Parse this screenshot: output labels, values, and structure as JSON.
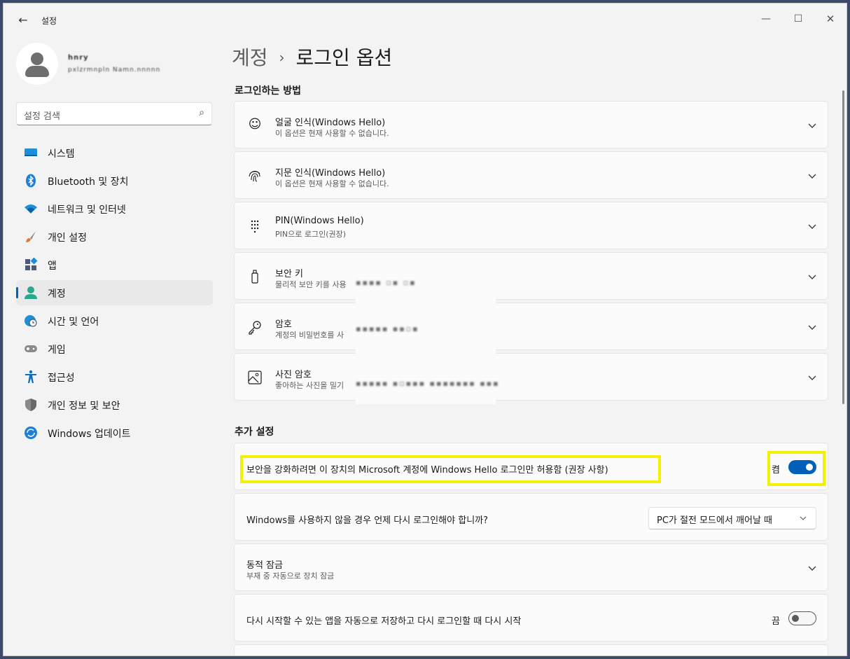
{
  "window": {
    "title": "설정",
    "controls": {
      "minimize": "—",
      "maximize": "☐",
      "close": "✕"
    }
  },
  "profile": {
    "name": "hnry",
    "email": "pxlzrmnpln Namn.nnnnn"
  },
  "search": {
    "placeholder": "설정 검색"
  },
  "sidebar": {
    "items": [
      {
        "label": "시스템",
        "icon": "monitor-icon"
      },
      {
        "label": "Bluetooth 및 장치",
        "icon": "bluetooth-icon"
      },
      {
        "label": "네트워크 및 인터넷",
        "icon": "wifi-icon"
      },
      {
        "label": "개인 설정",
        "icon": "brush-icon"
      },
      {
        "label": "앱",
        "icon": "apps-icon"
      },
      {
        "label": "계정",
        "icon": "account-icon",
        "active": true
      },
      {
        "label": "시간 및 언어",
        "icon": "globe-clock-icon"
      },
      {
        "label": "게임",
        "icon": "gamepad-icon"
      },
      {
        "label": "접근성",
        "icon": "accessibility-icon"
      },
      {
        "label": "개인 정보 및 보안",
        "icon": "shield-icon"
      },
      {
        "label": "Windows 업데이트",
        "icon": "update-icon"
      }
    ]
  },
  "breadcrumb": {
    "parent": "계정",
    "separator": "›",
    "current": "로그인 옵션"
  },
  "sections": {
    "signin_methods": "로그인하는 방법",
    "additional": "추가 설정"
  },
  "signin_methods": [
    {
      "title": "얼굴 인식(Windows Hello)",
      "subtitle": "이 옵션은 현재 사용할 수 없습니다.",
      "icon": "face-icon"
    },
    {
      "title": "지문 인식(Windows Hello)",
      "subtitle": "이 옵션은 현재 사용할 수 없습니다.",
      "icon": "fingerprint-icon"
    },
    {
      "title": "PIN(Windows Hello)",
      "subtitle": "PIN으로 로그인(권장)",
      "icon": "pin-keypad-icon"
    },
    {
      "title": "보안 키",
      "subtitle": "물리적 보안 키를 사용",
      "icon": "usb-key-icon"
    },
    {
      "title": "암호",
      "subtitle": "계정의 비밀번호를 사",
      "icon": "key-icon"
    },
    {
      "title": "사진 암호",
      "subtitle": "좋아하는 사진을 밀기",
      "icon": "picture-icon"
    }
  ],
  "additional": {
    "hello_only": {
      "label": "보안을 강화하려면 이 장치의 Microsoft 계정에 Windows Hello 로그인만 허용함 (권장 사항)",
      "state": "켬",
      "on": true
    },
    "require_signin": {
      "label": "Windows를 사용하지 않을 경우 언제 다시 로그인해야 합니까?",
      "value": "PC가 절전 모드에서 깨어날 때"
    },
    "dynamic_lock": {
      "title": "동적 잠금",
      "subtitle": "부재 중 자동으로 장치 잠금"
    },
    "restart_apps": {
      "label": "다시 시작할 수 있는 앱을 자동으로 저장하고 다시 로그인할 때 다시 시작",
      "state": "끔",
      "on": false
    }
  },
  "colors": {
    "accent": "#005fb8",
    "highlight": "#f3f000",
    "background": "#f3f3f3",
    "card": "#fbfbfb"
  }
}
